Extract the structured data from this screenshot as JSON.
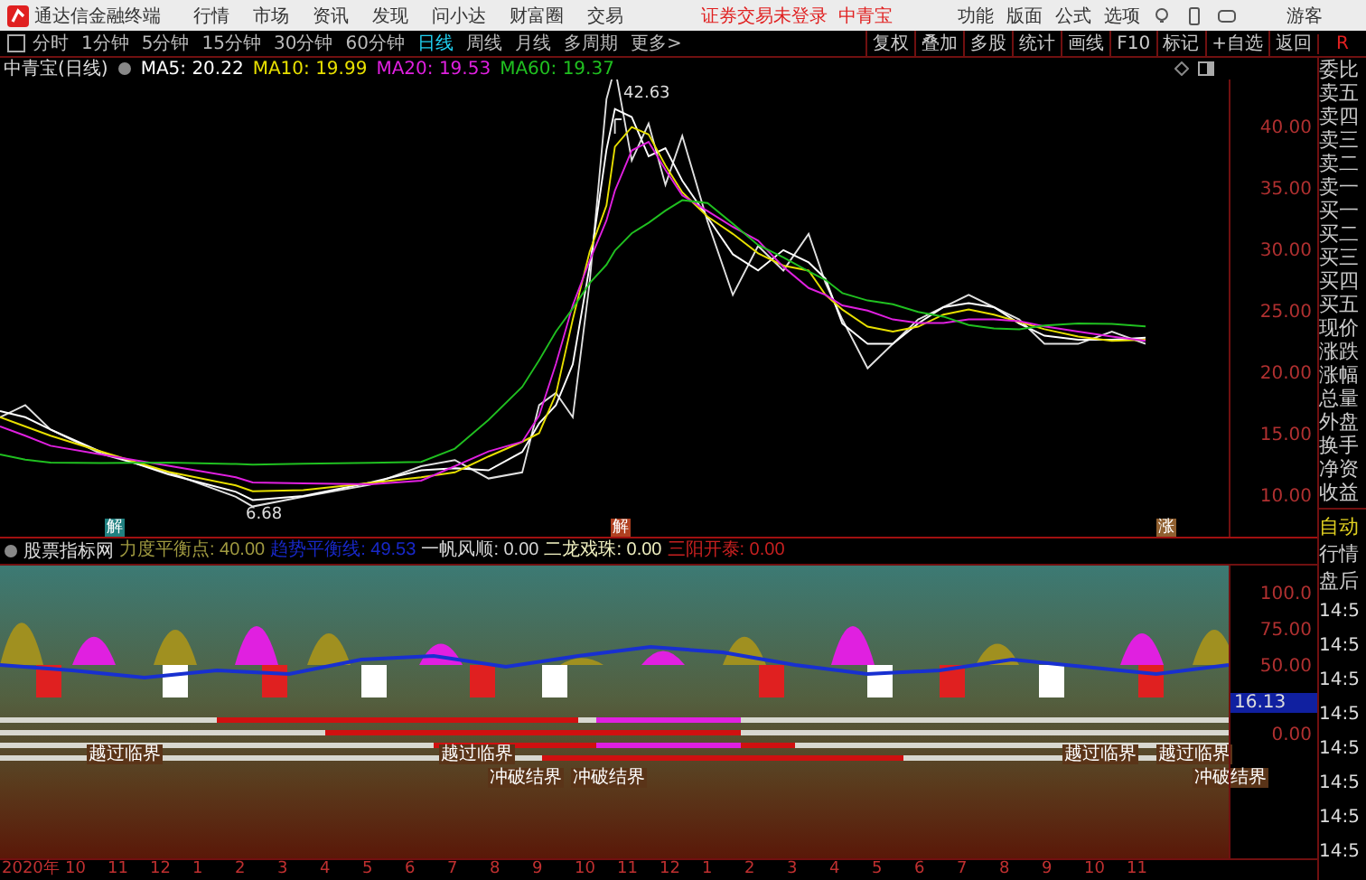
{
  "app": {
    "title": "通达信金融终端",
    "menus": [
      "行情",
      "市场",
      "资讯",
      "发现",
      "问小达",
      "财富圈",
      "交易"
    ],
    "notice": "证券交易未登录",
    "stock": "中青宝",
    "right_menus": [
      "功能",
      "版面",
      "公式",
      "选项"
    ],
    "user": "游客"
  },
  "periods": [
    {
      "label": "分时",
      "selected": false
    },
    {
      "label": "1分钟",
      "selected": false
    },
    {
      "label": "5分钟",
      "selected": false
    },
    {
      "label": "15分钟",
      "selected": false
    },
    {
      "label": "30分钟",
      "selected": false
    },
    {
      "label": "60分钟",
      "selected": false
    },
    {
      "label": "日线",
      "selected": true
    },
    {
      "label": "周线",
      "selected": false
    },
    {
      "label": "月线",
      "selected": false
    },
    {
      "label": "多周期",
      "selected": false
    },
    {
      "label": "更多>",
      "selected": false
    }
  ],
  "tools": [
    "复权",
    "叠加",
    "多股",
    "统计",
    "画线",
    "F10",
    "标记",
    "+自选",
    "返回"
  ],
  "main_chart": {
    "title": "中青宝(日线)",
    "ma": [
      {
        "label": "MA5: 20.22",
        "color": "#ffffff"
      },
      {
        "label": "MA10: 19.99",
        "color": "#e8e000"
      },
      {
        "label": "MA20: 19.53",
        "color": "#e020e0"
      },
      {
        "label": "MA60: 19.37",
        "color": "#20c020"
      }
    ],
    "high": "42.63",
    "low": "6.68",
    "markers": [
      "解",
      "解",
      "涨"
    ],
    "axis": [
      "40.00",
      "35.00",
      "30.00",
      "25.00",
      "20.00",
      "15.00",
      "10.00"
    ]
  },
  "indicator": {
    "name": "股票指标网",
    "values": [
      {
        "label": "力度平衡点: 40.00",
        "color": "#a09a40"
      },
      {
        "label": "趋势平衡线: 49.53",
        "color": "#1828c8"
      },
      {
        "label": "一帆风顺: 0.00",
        "color": "#d8d8d8"
      },
      {
        "label": "二龙戏珠: 0.00",
        "color": "#f0f0c0"
      },
      {
        "label": "三阳开泰: 0.00",
        "color": "#c82020"
      }
    ],
    "axis": [
      "100.0",
      "75.00",
      "50.00",
      "0.00"
    ],
    "current": "16.13",
    "signals": [
      "越过临界",
      "越过临界",
      "冲破结界",
      "冲破结界",
      "越过临界",
      "越过临界",
      "冲破结界"
    ],
    "dates": [
      "2020年",
      "10",
      "11",
      "12",
      "1",
      "2",
      "3",
      "4",
      "5",
      "6",
      "7",
      "8",
      "9",
      "10",
      "11",
      "12",
      "1",
      "2",
      "3",
      "4",
      "5",
      "6",
      "7",
      "8",
      "9",
      "10",
      "11"
    ]
  },
  "quote_panel": {
    "badge": "R",
    "labels": [
      "委比",
      "卖五",
      "卖四",
      "卖三",
      "卖二",
      "卖一",
      "买一",
      "买二",
      "买三",
      "买四",
      "买五",
      "现价",
      "涨跌",
      "涨幅",
      "总量",
      "外盘",
      "换手",
      "净资",
      "收益"
    ],
    "modes": [
      "自动",
      "行情",
      "盘后"
    ],
    "times": [
      "14:5",
      "14:5",
      "14:5",
      "14:5",
      "14:5",
      "14:5",
      "14:5",
      "14:5"
    ]
  }
}
